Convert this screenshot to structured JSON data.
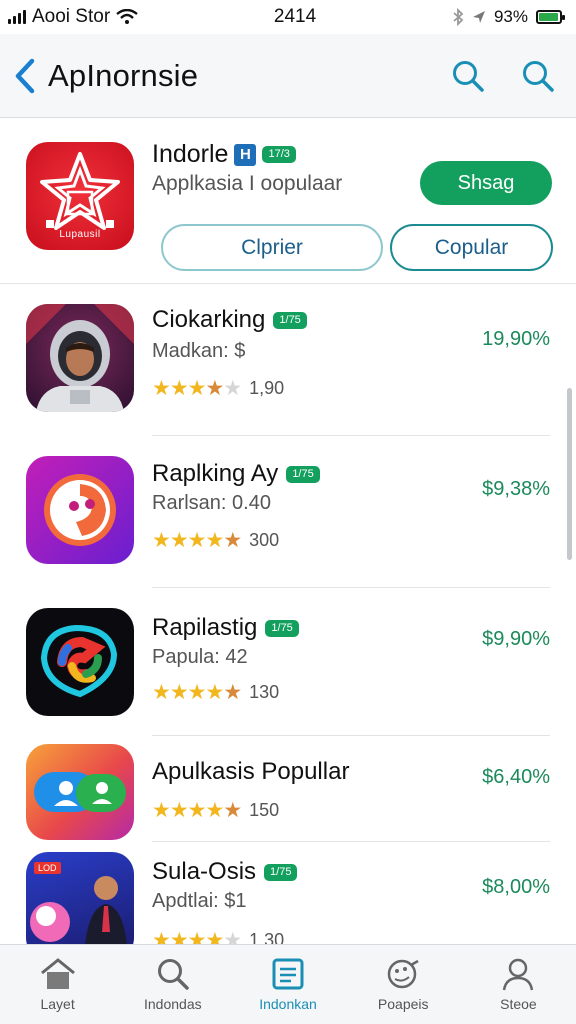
{
  "status_bar": {
    "carrier": "Aooi Stor",
    "time": "2414",
    "battery": "93%",
    "battery_level": 0.93
  },
  "nav": {
    "title": "ApInornsie",
    "icons": [
      "back-chevron-icon",
      "search-icon",
      "search-icon"
    ]
  },
  "featured": {
    "name": "Indorle",
    "badge_letter": "H",
    "tag": "17/3",
    "subtitle": "Applkasia  I oopulaar",
    "share_label": "Shsag",
    "pill_1": "Clprier",
    "pill_2": "Copular",
    "icon_label": "Lupausil"
  },
  "apps": [
    {
      "name": "Ciokarking",
      "tag": "1/75",
      "subtitle": "Madkan: $",
      "rating": 3.5,
      "rating_count": "1,90",
      "price": "19,90%"
    },
    {
      "name": "Raplking Ay",
      "tag": "1/75",
      "subtitle": "Rarlsan: 0.40",
      "rating": 4.5,
      "rating_count": "300",
      "price": "$9,38%"
    },
    {
      "name": "Rapilastig",
      "tag": "1/75",
      "subtitle": "Papula: 42",
      "rating": 4.5,
      "rating_count": "130",
      "price": "$9,90%"
    },
    {
      "name": "Apulkasis Popullar",
      "tag": "",
      "subtitle": "",
      "rating": 4.5,
      "rating_count": "150",
      "price": "$6,40%"
    },
    {
      "name": "Sula-Osis",
      "tag": "1/75",
      "subtitle": "Apdtlai: $1",
      "rating": 4,
      "rating_count": "1.30",
      "price": "$8,00%",
      "icon_label": "LOD"
    }
  ],
  "tabs": [
    {
      "label": "Layet",
      "icon": "home-icon"
    },
    {
      "label": "Indondas",
      "icon": "search-icon"
    },
    {
      "label": "Indonkan",
      "icon": "list-icon",
      "active": true
    },
    {
      "label": "Poapeis",
      "icon": "games-icon"
    },
    {
      "label": "Steoe",
      "icon": "profile-icon"
    }
  ],
  "colors": {
    "accent_green": "#13a05f",
    "accent_blue": "#1a8fb5",
    "price_green": "#1b8a5a",
    "star_gold": "#f2b61e"
  }
}
